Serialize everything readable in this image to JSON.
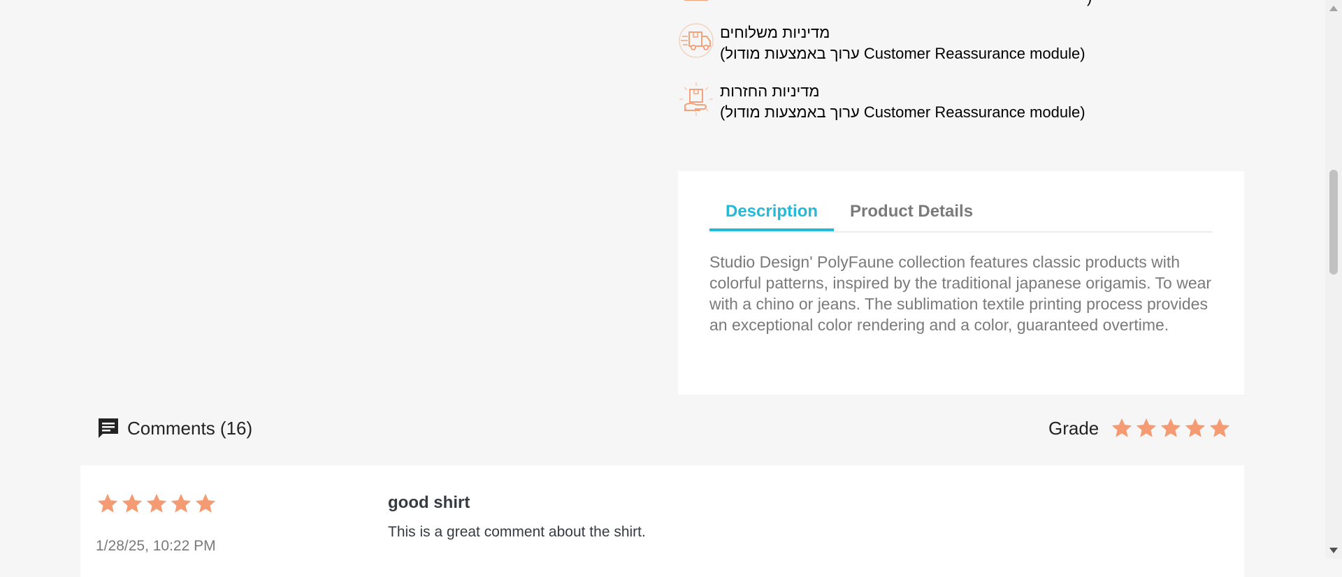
{
  "reassurance": {
    "items": [
      {
        "icon": "delivery-truck-icon",
        "title": "מדיניות משלוחים",
        "subtitle": "(ערוך באמצעות מודול Customer Reassurance module)"
      },
      {
        "icon": "return-package-icon",
        "title": "מדיניות החזרות",
        "subtitle": "(ערוך באמצעות מודול Customer Reassurance module)"
      }
    ],
    "cut_text": ")"
  },
  "tabs": {
    "items": [
      {
        "label": "Description",
        "active": true
      },
      {
        "label": "Product Details",
        "active": false
      }
    ],
    "description": "Studio Design' PolyFaune collection features classic products with colorful patterns, inspired by the traditional japanese origamis. To wear with a chino or jeans. The sublimation textile printing process provides an exceptional color rendering and a color, guaranteed overtime."
  },
  "comments": {
    "title": "Comments (16)",
    "grade_label": "Grade",
    "grade_stars": 5,
    "list": [
      {
        "stars": 5,
        "date": "1/28/25, 10:22 PM",
        "title": "good shirt",
        "body": "This is a great comment about the shirt."
      }
    ]
  },
  "colors": {
    "accent": "#24b9d7",
    "star": "#f49b73",
    "icon": "#f4a27b"
  }
}
